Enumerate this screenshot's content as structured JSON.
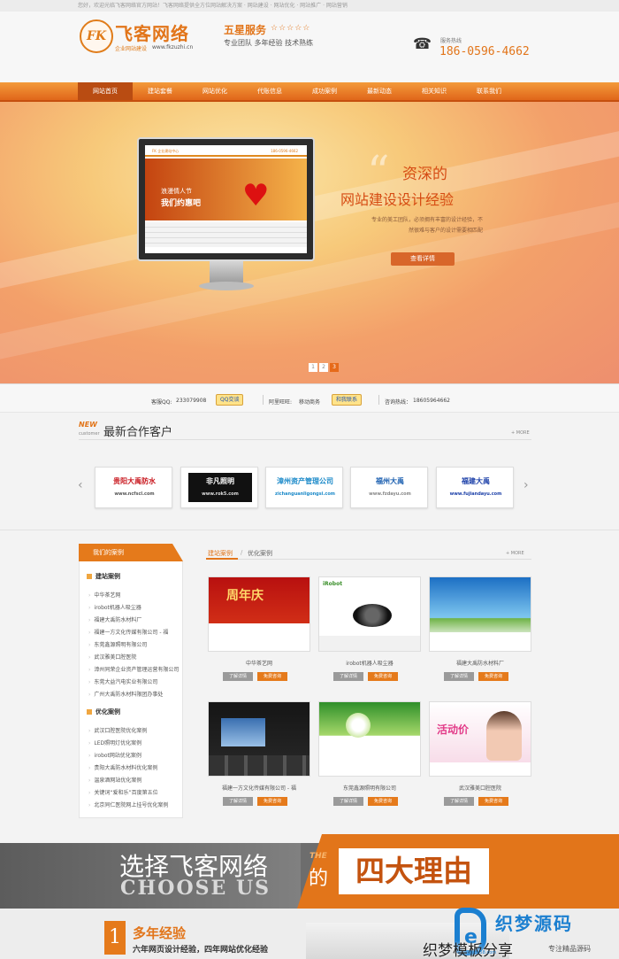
{
  "topbar": {
    "text": "您好，欢迎光临飞客网络官方网站！飞客网络提供全方位网站解决方案 · 网站建设 · 网站优化 · 网站推广 · 网站营销"
  },
  "header": {
    "logo_mark": "FK",
    "logo_name": "飞客网络",
    "logo_sub": "企业网站建设",
    "logo_url": "www.fkzuzhi.cn",
    "slogan_title": "五星服务",
    "slogan_stars": "☆☆☆☆☆",
    "slogan_sub": "专业团队  多年经验  技术熟练",
    "phone_icon": "☎",
    "hotline_label": "服务热线",
    "hotline_number": "186-0596-4662"
  },
  "nav": [
    "网站首页",
    "建站套餐",
    "网站优化",
    "代账信息",
    "成功案例",
    "最新动态",
    "相关知识",
    "联系我们"
  ],
  "banner": {
    "quote": "“",
    "title1": "资深的",
    "title2": "网站建设设计经验",
    "desc": "专业的美工团队，必须拥有丰富的设计经验，不然很难与客户的设计需要相匹配",
    "button": "查看详情",
    "screen_hdr": "FK 企业建站中心",
    "screen_phone": "186-0596-4662",
    "screen_t1": "浪漫情人节",
    "screen_t2": "我们约惠吧",
    "heart": "♥",
    "dots": [
      "1",
      "2",
      "3"
    ]
  },
  "contact": {
    "qq_label": "客服QQ:",
    "qq_number": "233079908",
    "qq_button": "QQ交谈",
    "ww_label": "阿里旺旺:",
    "ww_name": "移动商务",
    "ww_button": "和我联系",
    "hotline_label": "咨询热线：",
    "hotline_number": "18605964662"
  },
  "partners": {
    "new_label": "NEW",
    "customer_label": "customer",
    "title": "最新合作客户",
    "more": "+ MORE",
    "prev_arrow": "‹",
    "next_arrow": "›",
    "logos": [
      {
        "name": "贵阳大禹防水",
        "url": "www.ncfscl.com",
        "color": "#c8161d"
      },
      {
        "name": "非凡照明",
        "url": "www.rok5.com",
        "color": "#ffffff"
      },
      {
        "name": "漳州资产管理公司",
        "url": "zichanguanligongsi.com",
        "color": "#1c8ac9"
      },
      {
        "name": "福州大禹",
        "url": "www.fzdayu.com",
        "color": "#1b5fb0"
      },
      {
        "name": "福建大禹",
        "url": "www.fujiandayu.com",
        "color": "#1b3fa8"
      }
    ]
  },
  "sidebar": {
    "head": "我们的案例",
    "cat1": "建站案例",
    "cat1_items": [
      "中华茶艺网",
      "irobot机器人吸尘器",
      "福建大禹防水材料厂",
      "福建一方文化传媒有限公司 - 福",
      "东莞鑫源照明有限公司",
      "武汉雅美口腔医院",
      "漳州同荣企业资产管理运营有限公司",
      "东莞大益汽电实业有限公司",
      "广州大禹防水材料限团办事处"
    ],
    "cat2": "优化案例",
    "cat2_items": [
      "武汉口腔医院优化案例",
      "LED照明灯优化案例",
      "irobot网站优化案例",
      "贵阳大禹防水材料优化案例",
      "温泉酒网站优化案例",
      "关键词“爱和乐”百度第五位",
      "北京同仁医院网上挂号优化案例"
    ]
  },
  "cases": {
    "tab_active": "建站案例",
    "tab_sep": "/",
    "tab_other": "优化案例",
    "more": "+ MORE",
    "items": [
      {
        "title": "中华茶艺网",
        "detail": "了解详情",
        "consult": "免费咨询",
        "thumb": "周年庆"
      },
      {
        "title": "irobot机器人吸尘器",
        "detail": "了解详情",
        "consult": "免费咨询",
        "thumb": "iRobot"
      },
      {
        "title": "福建大禹防水材料厂",
        "detail": "了解详情",
        "consult": "免费咨询",
        "thumb": ""
      },
      {
        "title": "福建一方文化传媒有限公司 - 福",
        "detail": "了解详情",
        "consult": "免费咨询",
        "thumb": ""
      },
      {
        "title": "东莞鑫源照明有限公司",
        "detail": "了解详情",
        "consult": "免费咨询",
        "thumb": ""
      },
      {
        "title": "武汉雅美口腔医院",
        "detail": "了解详情",
        "consult": "免费咨询",
        "thumb": "活动价"
      }
    ]
  },
  "choose": {
    "cn": "选择飞客网络",
    "en": "CHOOSE US",
    "the": "THE",
    "de": "的",
    "big": "四大理由"
  },
  "reason": {
    "num": "1",
    "title": "多年经验",
    "sub": "六年网页设计经验，四年网站优化经验"
  },
  "watermark": {
    "e": "e",
    "brand": "织梦源码",
    "text": "织梦模板分享",
    "url": "dede58.com",
    "slogan": "专注精品源码"
  }
}
